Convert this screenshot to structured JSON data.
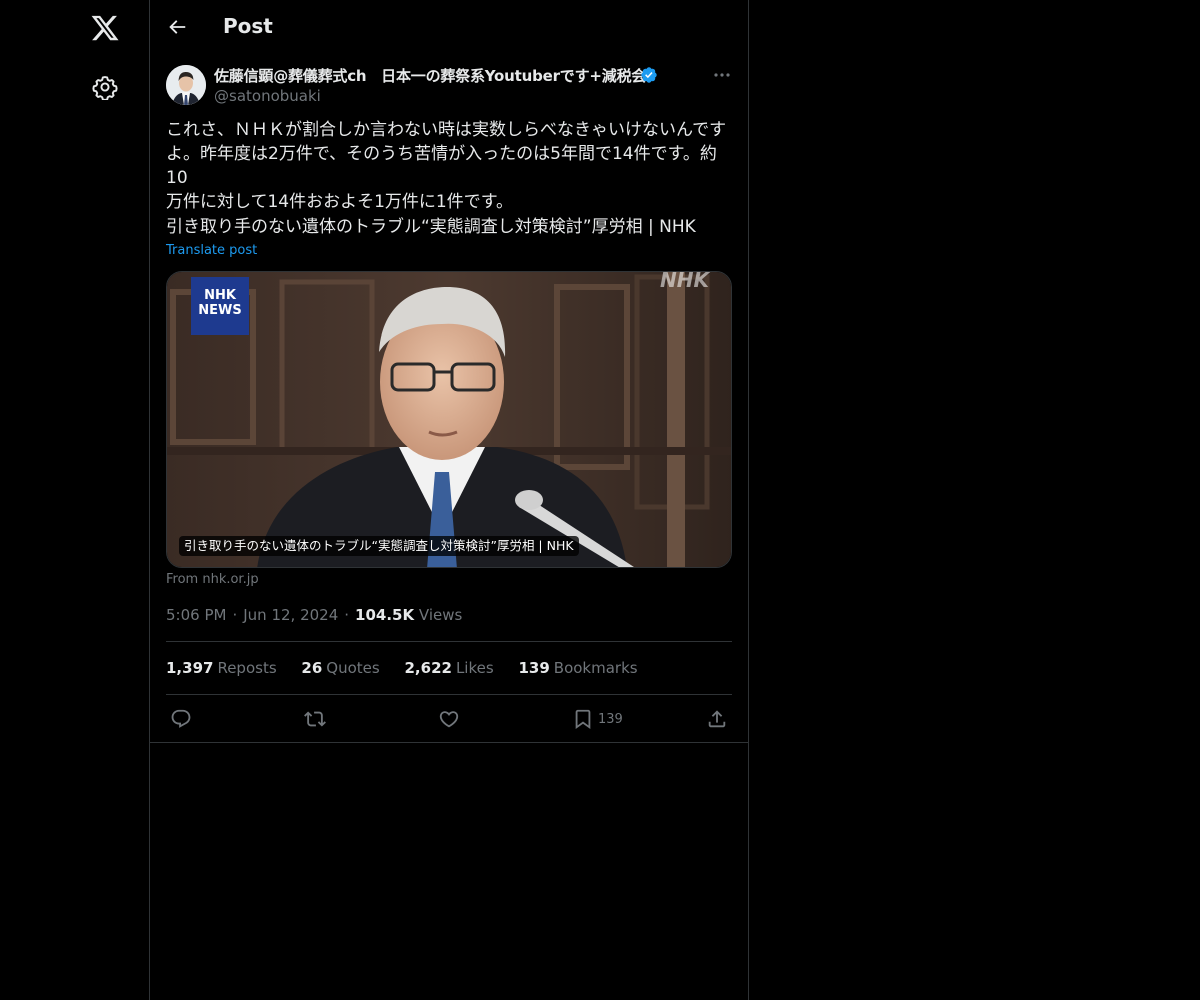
{
  "nav": {
    "logo_icon": "x-logo-icon",
    "settings_icon": "gear-icon"
  },
  "header": {
    "back_icon": "arrow-left-icon",
    "title": "Post"
  },
  "post": {
    "author": {
      "name": "佐藤信顕@葬儀葬式ch　日本一の葬祭系Youtuberです+減税会",
      "handle": "@satonobuaki",
      "verified": true,
      "verified_color": "#1d9bf0"
    },
    "text": "これさ、ＮＨＫが割合しか言わない時は実数しらべなきゃいけないんです\nよ。昨年度は2万件で、そのうち苦情が入ったのは5年間で14件です。約10\n万件に対して14件おおよそ1万件に1件です。",
    "link_title": "引き取り手のない遺体のトラブル“実態調査し対策検討”厚労相 | NHK",
    "translate_label": "Translate post",
    "card": {
      "badge_line1": "NHK",
      "badge_line2": "NEWS",
      "watermark": "NHK",
      "caption": "引き取り手のない遺体のトラブル“実態調査し対策検討”厚労相 | NHK",
      "source": "From nhk.or.jp"
    },
    "meta": {
      "time": "5:06 PM",
      "date": "Jun 12, 2024",
      "views_count": "104.5K",
      "views_label": "Views"
    },
    "stats": {
      "reposts_count": "1,397",
      "reposts_label": "Reposts",
      "quotes_count": "26",
      "quotes_label": "Quotes",
      "likes_count": "2,622",
      "likes_label": "Likes",
      "bookmarks_count": "139",
      "bookmarks_label": "Bookmarks"
    },
    "actions": {
      "reply_icon": "reply-icon",
      "repost_icon": "repost-icon",
      "like_icon": "heart-icon",
      "bookmark_icon": "bookmark-icon",
      "bookmark_count": "139",
      "share_icon": "share-icon"
    }
  },
  "colors": {
    "background": "#000000",
    "text_primary": "#e7e9ea",
    "text_secondary": "#71767b",
    "border": "#2f3336",
    "accent": "#1d9bf0",
    "nhk_badge": "#1e3a8f"
  }
}
